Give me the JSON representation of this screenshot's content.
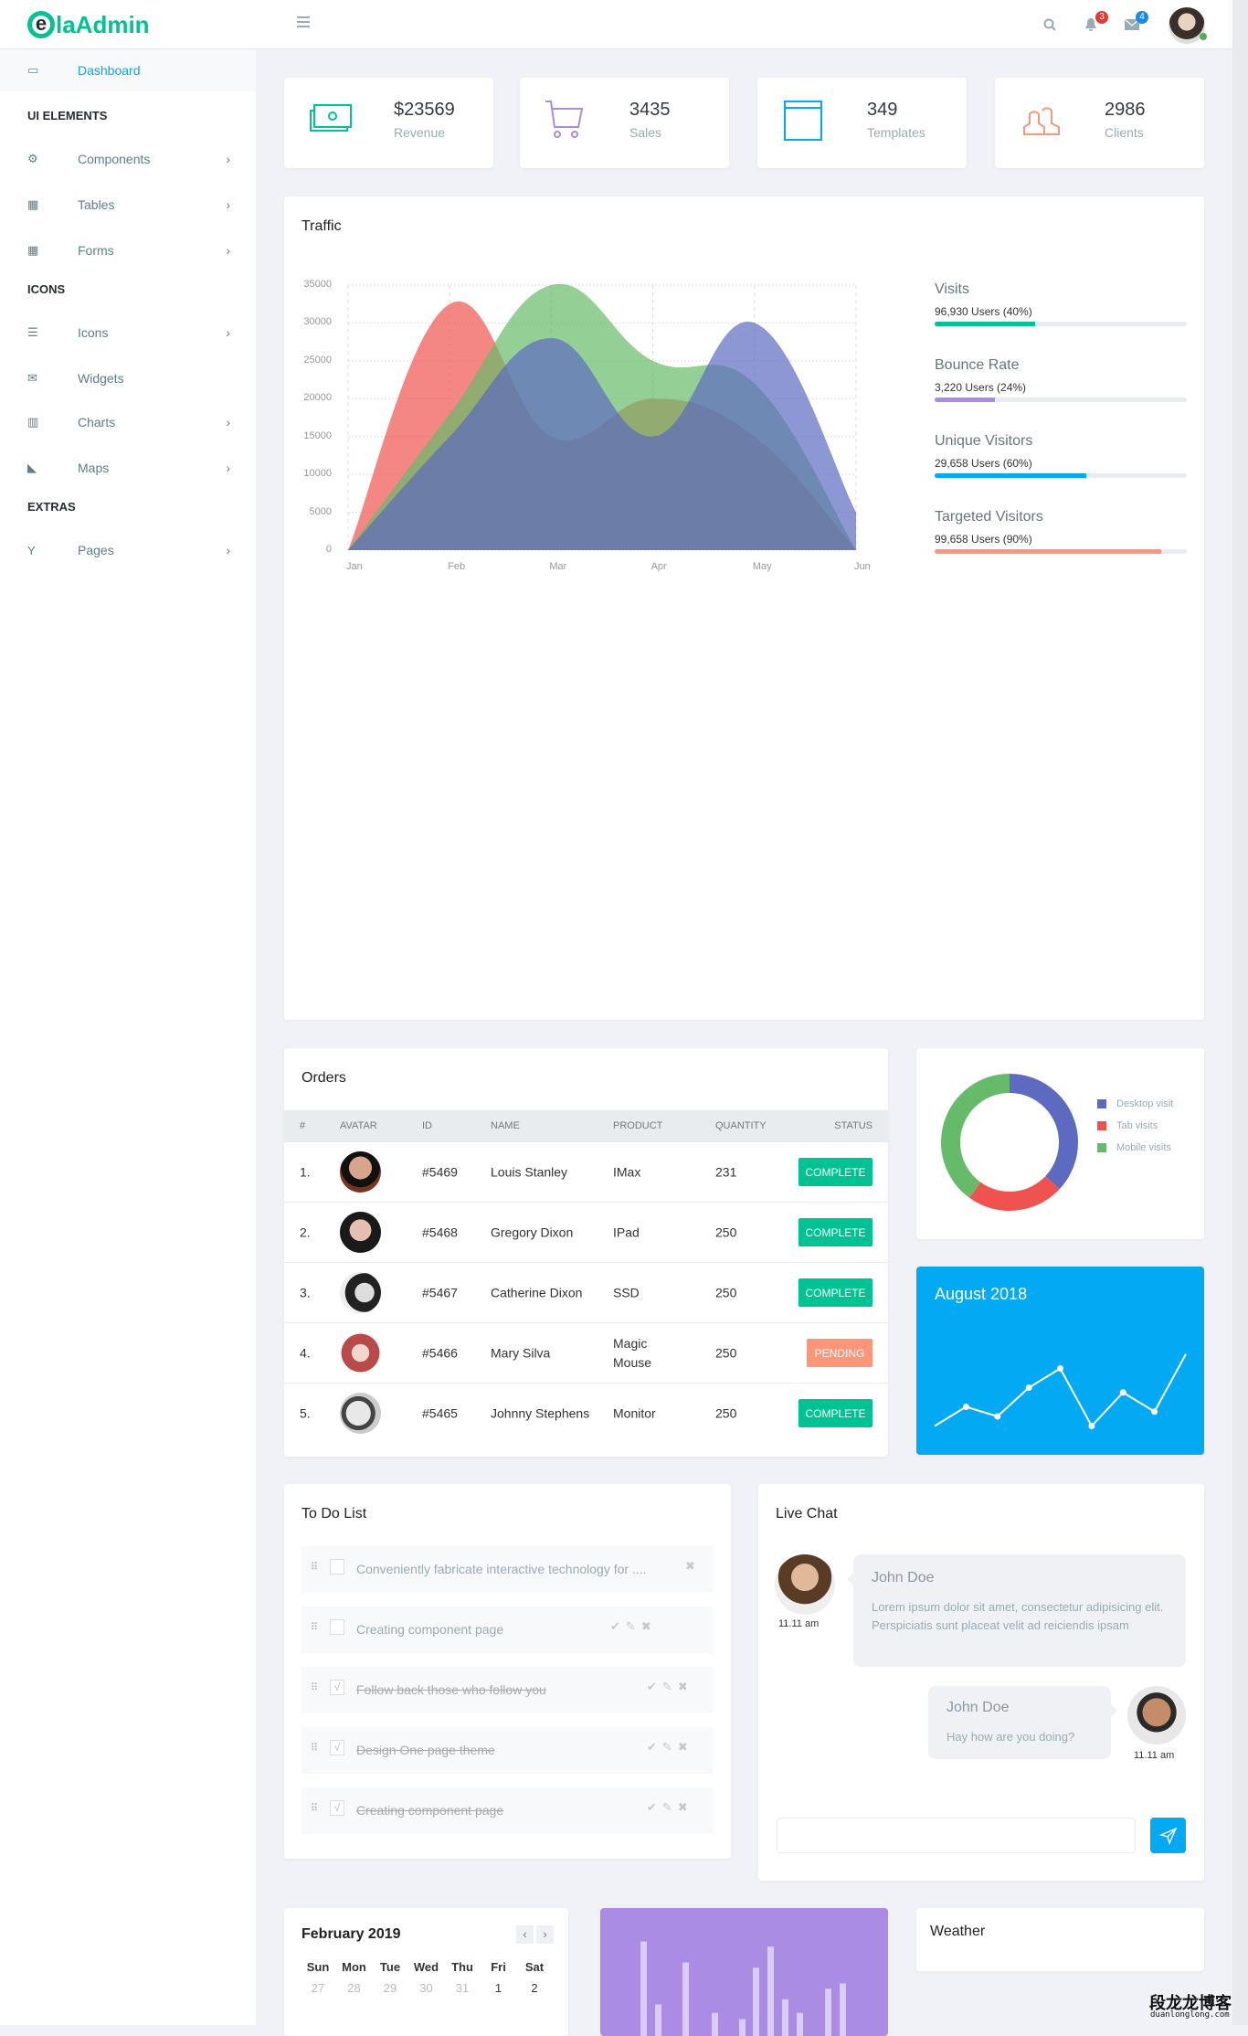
{
  "header": {
    "logo_e": "e",
    "logo_text": "laAdmin",
    "notif_count": "3",
    "mail_count": "4",
    "icons": [
      "menu-icon",
      "search-icon",
      "bell-icon",
      "mail-icon",
      "user-avatar"
    ]
  },
  "sidebar": {
    "active": {
      "label": "Dashboard",
      "icon": "laptop-icon"
    },
    "sections": [
      {
        "title": "UI ELEMENTS",
        "items": [
          {
            "label": "Components",
            "icon": "cogs-icon",
            "chevron": true
          },
          {
            "label": "Tables",
            "icon": "table-icon",
            "chevron": true
          },
          {
            "label": "Forms",
            "icon": "th-icon",
            "chevron": true
          }
        ]
      },
      {
        "title": "ICONS",
        "items": [
          {
            "label": "Icons",
            "icon": "tasks-icon",
            "chevron": true
          },
          {
            "label": "Widgets",
            "icon": "envelope-icon",
            "chevron": false
          },
          {
            "label": "Charts",
            "icon": "bar-chart-icon",
            "chevron": true
          },
          {
            "label": "Maps",
            "icon": "area-chart-icon",
            "chevron": true
          }
        ]
      },
      {
        "title": "EXTRAS",
        "items": [
          {
            "label": "Pages",
            "icon": "glass-icon",
            "chevron": true
          }
        ]
      }
    ]
  },
  "stats": [
    {
      "value": "$23569",
      "label": "Revenue",
      "icon": "money-icon",
      "color": "#00c292"
    },
    {
      "value": "3435",
      "label": "Sales",
      "icon": "cart-icon",
      "color": "#ab8ce4"
    },
    {
      "value": "349",
      "label": "Templates",
      "icon": "browser-icon",
      "color": "#03a9f3"
    },
    {
      "value": "2986",
      "label": "Clients",
      "icon": "users-icon",
      "color": "#fb9678"
    }
  ],
  "traffic": {
    "title": "Traffic",
    "progress": [
      {
        "title": "Visits",
        "sub": "96,930 Users (40%)",
        "percent": 40,
        "color": "#00c292"
      },
      {
        "title": "Bounce Rate",
        "sub": "3,220 Users (24%)",
        "percent": 24,
        "color": "#ab8ce4"
      },
      {
        "title": "Unique Visitors",
        "sub": "29,658 Users (60%)",
        "percent": 60,
        "color": "#03a9f3"
      },
      {
        "title": "Targeted Visitors",
        "sub": "99,658 Users (90%)",
        "percent": 90,
        "color": "#fb9678"
      }
    ]
  },
  "orders": {
    "title": "Orders",
    "columns": [
      "#",
      "AVATAR",
      "ID",
      "NAME",
      "PRODUCT",
      "QUANTITY",
      "STATUS"
    ],
    "rows": [
      {
        "num": "1.",
        "id": "#5469",
        "name": "Louis Stanley",
        "product": "IMax",
        "qty": "231",
        "status": "COMPLETE"
      },
      {
        "num": "2.",
        "id": "#5468",
        "name": "Gregory Dixon",
        "product": "IPad",
        "qty": "250",
        "status": "COMPLETE"
      },
      {
        "num": "3.",
        "id": "#5467",
        "name": "Catherine Dixon",
        "product": "SSD",
        "qty": "250",
        "status": "COMPLETE"
      },
      {
        "num": "4.",
        "id": "#5466",
        "name": "Mary Silva",
        "product": "Magic Mouse",
        "qty": "250",
        "status": "PENDING"
      },
      {
        "num": "5.",
        "id": "#5465",
        "name": "Johnny Stephens",
        "product": "Monitor",
        "qty": "250",
        "status": "COMPLETE"
      }
    ],
    "status_colors": {
      "COMPLETE": "#00c292",
      "PENDING": "#fb9678"
    }
  },
  "august": {
    "title": "August 2018",
    "bg": "#03a9f3"
  },
  "todo": {
    "title": "To Do List",
    "items": [
      {
        "text": "Conveniently fabricate interactive technology for ....",
        "done": false
      },
      {
        "text": "Creating component page",
        "done": false
      },
      {
        "text": "Follow back those who follow you",
        "done": true
      },
      {
        "text": "Design One page theme",
        "done": true
      },
      {
        "text": "Creating component page",
        "done": true
      }
    ]
  },
  "chat": {
    "title": "Live Chat",
    "messages": [
      {
        "name": "John Doe",
        "text": "Lorem ipsum dolor sit amet, consectetur adipisicing elit. Perspiciatis sunt placeat velit ad reiciendis ipsam",
        "time": "11.11 am",
        "side": "left"
      },
      {
        "name": "John Doe",
        "text": "Hay how are you doing?",
        "time": "11.11 am",
        "side": "right"
      }
    ],
    "input_value": "",
    "send_icon": "paper-plane-icon"
  },
  "calendar": {
    "title": "February 2019",
    "days": [
      "Sun",
      "Mon",
      "Tue",
      "Wed",
      "Thu",
      "Fri",
      "Sat"
    ],
    "dates": [
      {
        "d": "27",
        "muted": true
      },
      {
        "d": "28",
        "muted": true
      },
      {
        "d": "29",
        "muted": true
      },
      {
        "d": "30",
        "muted": true
      },
      {
        "d": "31",
        "muted": true
      },
      {
        "d": "1",
        "muted": false
      },
      {
        "d": "2",
        "muted": false
      }
    ]
  },
  "weather": {
    "title": "Weather"
  },
  "watermark": {
    "cn": "段龙龙博客",
    "url": "duanlonglong.com"
  },
  "chart_data": [
    {
      "type": "area",
      "x": [
        "Jan",
        "Feb",
        "Mar",
        "Apr",
        "May",
        "Jun"
      ],
      "ylim": [
        0,
        35000
      ],
      "yticks": [
        0,
        5000,
        10000,
        15000,
        20000,
        25000,
        30000,
        35000
      ],
      "grid": true,
      "series": [
        {
          "values": [
            0,
            32500,
            15000,
            20000,
            15000,
            0
          ],
          "color": "#ef5350"
        },
        {
          "values": [
            0,
            18000,
            35000,
            25000,
            22000,
            0
          ],
          "color": "#66bb6a"
        },
        {
          "values": [
            0,
            15000,
            28000,
            15000,
            30000,
            5000
          ],
          "color": "#5c6bc0"
        }
      ]
    },
    {
      "type": "pie",
      "donut": true,
      "legend": "right",
      "labels": [
        "Desktop visit",
        "Tab visits",
        "Mobile visits"
      ],
      "values": [
        37,
        23,
        40
      ],
      "colors": [
        "#5c6bc0",
        "#ef5350",
        "#66bb6a"
      ]
    },
    {
      "type": "line",
      "values": [
        10,
        30,
        20,
        50,
        70,
        10,
        45,
        25,
        85
      ],
      "color": "#ffffff"
    },
    {
      "type": "bar",
      "values": [
        90,
        30,
        70,
        22,
        16,
        65,
        85,
        35,
        22,
        45,
        50
      ],
      "color": "#d9ccf5"
    }
  ]
}
